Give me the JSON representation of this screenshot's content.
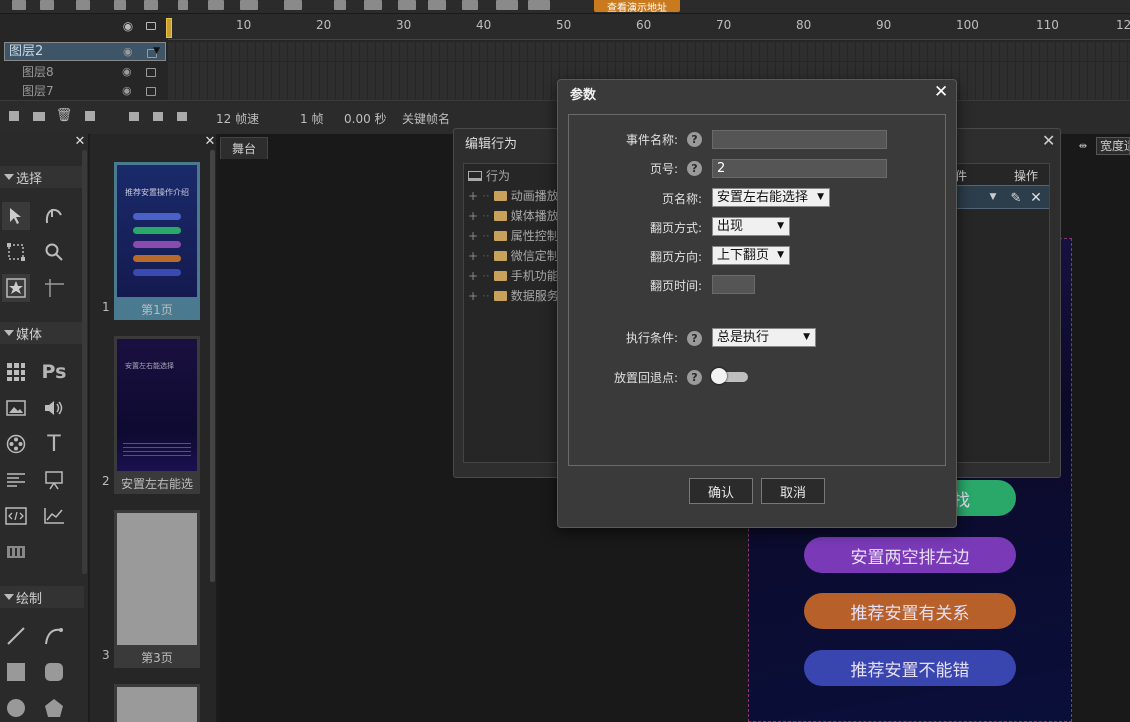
{
  "toolbar": {
    "orange_button": "查看演示地址"
  },
  "timeline": {
    "ruler_ticks": [
      "10",
      "20",
      "30",
      "40",
      "50",
      "60",
      "70",
      "80",
      "90",
      "100",
      "110",
      "12"
    ],
    "layers": [
      {
        "label": "图层2",
        "selected": true
      },
      {
        "label": "图层8",
        "selected": false
      },
      {
        "label": "图层7",
        "selected": false
      }
    ]
  },
  "infobar": {
    "fps": "12 帧速",
    "frame": "1 帧",
    "time": "0.00 秒",
    "keyframe_name": "关键帧名"
  },
  "tools": {
    "sections": {
      "select": "选择",
      "media": "媒体",
      "draw": "绘制"
    },
    "ps_label": "Ps",
    "text_label": "T"
  },
  "pages": [
    {
      "num": "1",
      "label": "第1页"
    },
    {
      "num": "2",
      "label": "安置左右能选"
    },
    {
      "num": "3",
      "label": "第3页"
    }
  ],
  "thumb1": {
    "title": "推荐安置操作介绍"
  },
  "thumb2": {
    "title": "安置左右能选择"
  },
  "stage": {
    "tab": "舞台",
    "pills": [
      "找",
      "安置两空排左边",
      "推荐安置有关系",
      "推荐安置不能错"
    ]
  },
  "behavior": {
    "title": "编辑行为",
    "root": "行为",
    "items": [
      "动画播放控制",
      "媒体播放控制",
      "属性控制",
      "微信定制",
      "手机功能",
      "数据服务"
    ],
    "col_condition": "件",
    "col_action": "操作",
    "width_field": "宽度适配"
  },
  "dialog": {
    "title": "参数",
    "fields": {
      "event_name": {
        "label": "事件名称:",
        "value": ""
      },
      "page_num": {
        "label": "页号:",
        "value": "2"
      },
      "page_name": {
        "label": "页名称:",
        "value": "安置左右能选择"
      },
      "flip_mode": {
        "label": "翻页方式:",
        "value": "出现"
      },
      "flip_dir": {
        "label": "翻页方向:",
        "value": "上下翻页"
      },
      "flip_time": {
        "label": "翻页时间:",
        "value": ""
      },
      "exec_cond": {
        "label": "执行条件:",
        "value": "总是执行"
      },
      "fallback": {
        "label": "放置回退点:"
      }
    },
    "help": "?",
    "confirm": "确认",
    "cancel": "取消"
  }
}
